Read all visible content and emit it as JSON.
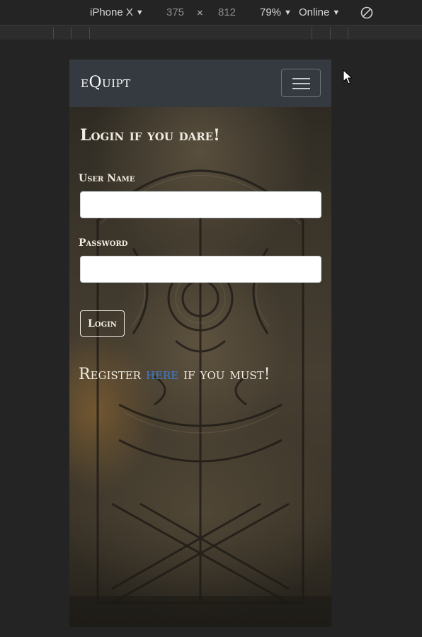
{
  "devtools": {
    "device": "iPhone X",
    "width": "375",
    "times": "×",
    "height": "812",
    "zoom": "79%",
    "network": "Online",
    "caret": "▼"
  },
  "app": {
    "brand": "eQuipt",
    "login_title": "Login if you dare!",
    "username_label": "User Name",
    "username_value": "",
    "password_label": "Password",
    "password_value": "",
    "login_button": "Login",
    "register_prefix": "Register ",
    "register_link": "here",
    "register_suffix": " if you must!",
    "link_color": "#3b7dd8"
  }
}
